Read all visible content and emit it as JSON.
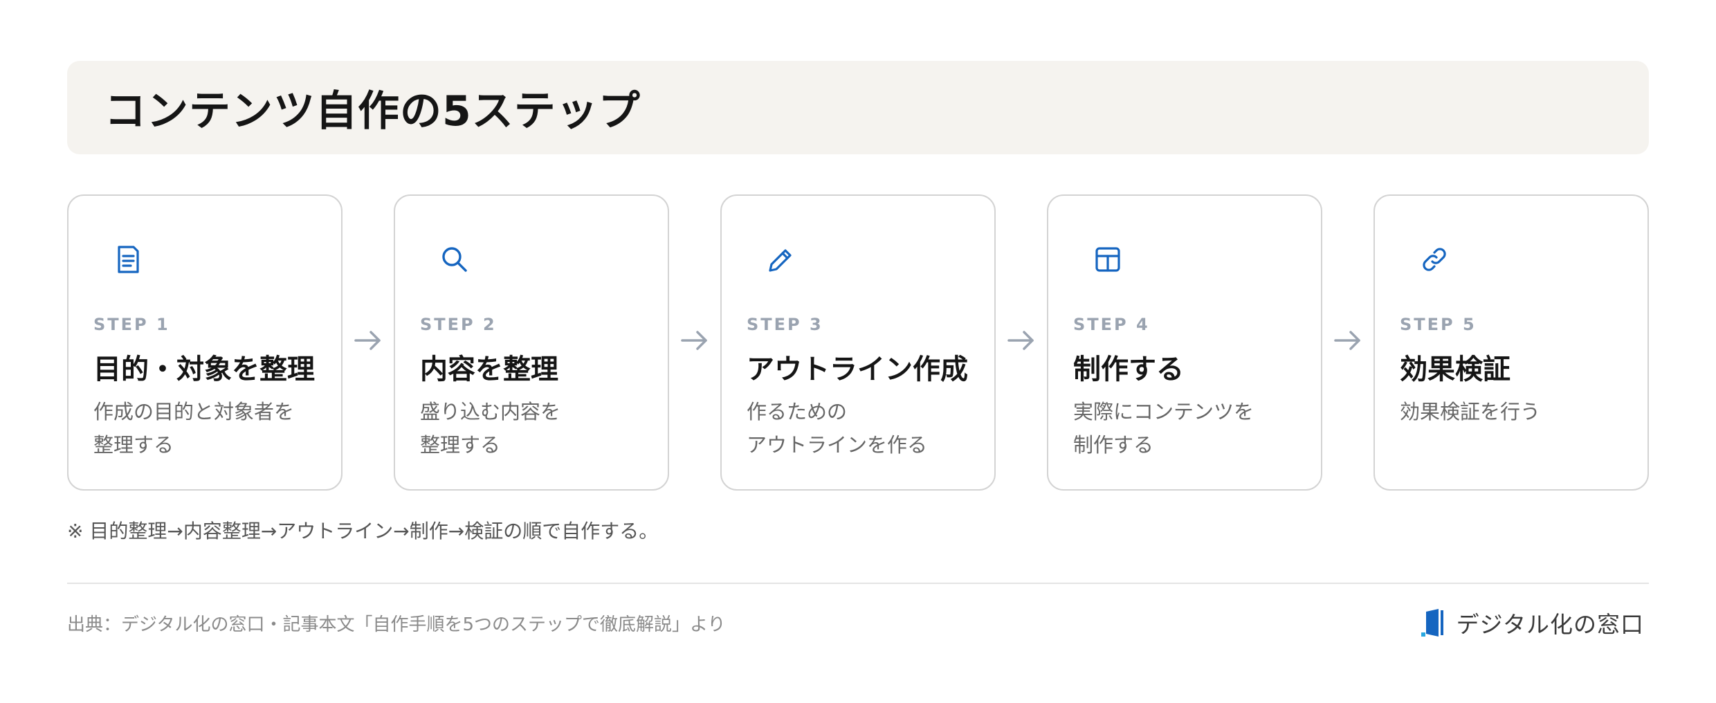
{
  "header": {
    "title": "コンテンツ自作の5ステップ"
  },
  "steps": [
    {
      "icon": "document-icon",
      "label": "STEP 1",
      "title": "目的・対象を整理",
      "description": "作成の目的と対象者を\n整理する"
    },
    {
      "icon": "search-icon",
      "label": "STEP 2",
      "title": "内容を整理",
      "description": "盛り込む内容を\n整理する"
    },
    {
      "icon": "pencil-icon",
      "label": "STEP 3",
      "title": "アウトライン作成",
      "description": "作るための\nアウトラインを作る"
    },
    {
      "icon": "layout-icon",
      "label": "STEP 4",
      "title": "制作する",
      "description": "実際にコンテンツを\n制作する"
    },
    {
      "icon": "link-icon",
      "label": "STEP 5",
      "title": "効果検証",
      "description": "効果検証を行う"
    }
  ],
  "note": "※ 目的整理→内容整理→アウトライン→制作→検証の順で自作する。",
  "footer": {
    "source": "出典：デジタル化の窓口・記事本文「自作手順を5つのステップで徹底解説」より",
    "logo_text": "デジタル化の窓口"
  },
  "colors": {
    "accent": "#1565c0",
    "banner_bg": "#f5f3ef",
    "step_label": "#9aa3b0",
    "arrow": "#9aa3b0"
  }
}
